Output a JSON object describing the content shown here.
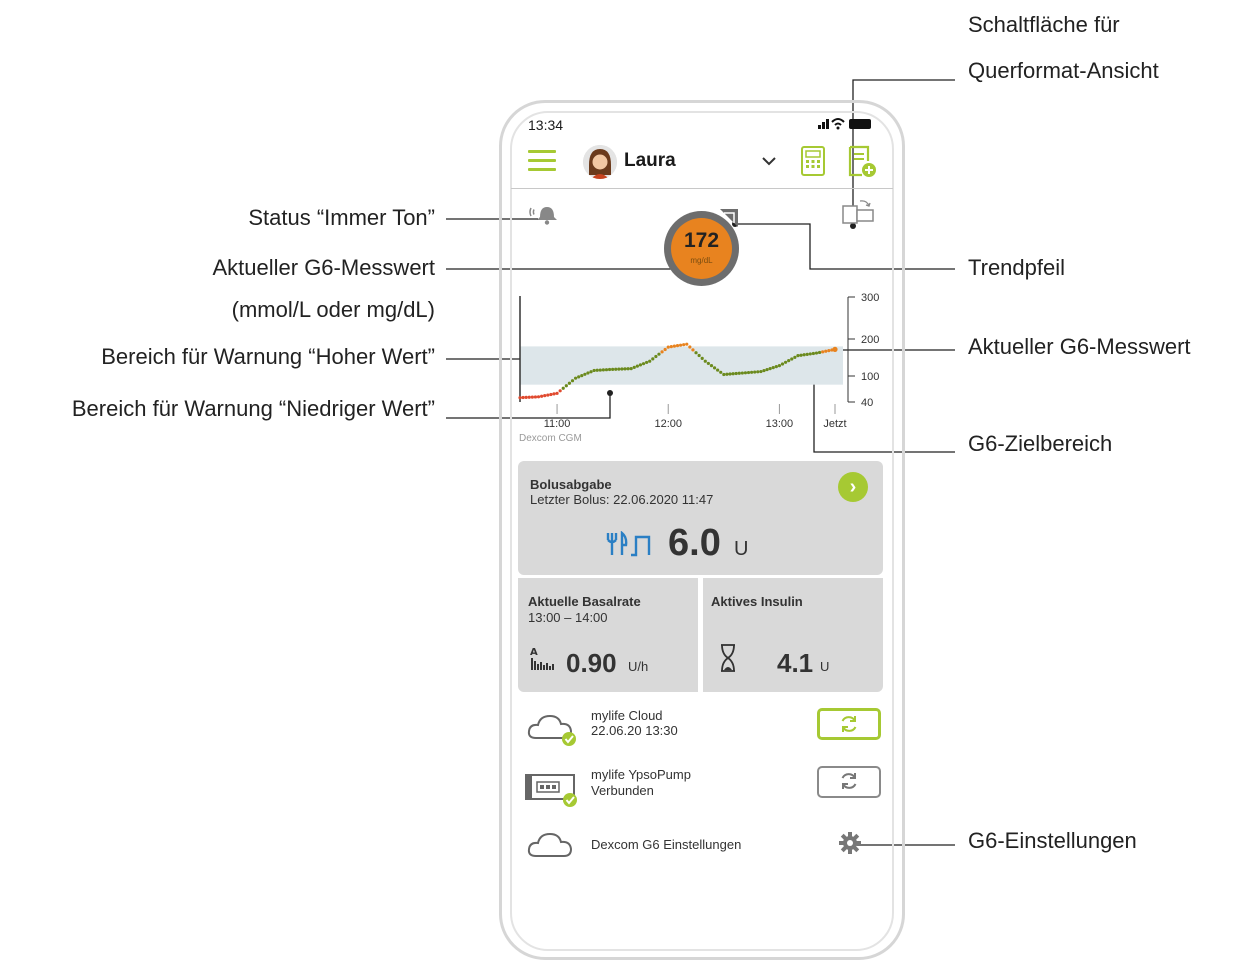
{
  "callouts": {
    "landscape_button_line1": "Schaltfläche für",
    "landscape_button_line2": "Querformat-Ansicht",
    "always_sound_status": "Status “Immer Ton”",
    "current_reading_left": "Aktueller G6-Messwert",
    "current_reading_units": "(mmol/L oder mg/dL)",
    "trend_arrow": "Trendpfeil",
    "current_reading_right": "Aktueller G6-Messwert",
    "high_alert_range": "Bereich für Warnung “Hoher Wert”",
    "low_alert_range": "Bereich für Warnung “Niedriger Wert”",
    "target_range": "G6-Zielbereich",
    "g6_settings": "G6-Einstellungen"
  },
  "status_bar": {
    "time": "13:34",
    "icons": "signal-icon wifi-icon battery-icon"
  },
  "header": {
    "user_name": "Laura",
    "dropdown_icon": "chevron-down-icon",
    "calculator_icon": "calculator-icon",
    "logbook_icon": "logbook-add-icon"
  },
  "glucose": {
    "value": "172",
    "unit": "mg/dL",
    "trend": "trend-arrow-right-up"
  },
  "colors": {
    "accent": "#a6c933",
    "glucose_orange": "#e8831f",
    "in_range_green": "#6b8a1e",
    "low_red": "#e04a2f",
    "target_band": "#dde6ea",
    "card_bg": "#d9d9d9"
  },
  "chart_data": {
    "type": "line",
    "source_label": "Dexcom CGM",
    "x_ticks": [
      "11:00",
      "12:00",
      "13:00",
      "Jetzt"
    ],
    "y_ticks": [
      "300",
      "200",
      "100",
      "40"
    ],
    "ylim": [
      40,
      300
    ],
    "target_range": [
      80,
      180
    ],
    "series": [
      {
        "x": [
          "10:40",
          "10:50",
          "11:00",
          "11:10",
          "11:20",
          "11:30",
          "11:40",
          "11:50",
          "12:00",
          "12:10",
          "12:20",
          "12:30",
          "12:40",
          "12:50",
          "13:00",
          "13:10",
          "13:20",
          "13:30"
        ],
        "y": [
          50,
          52,
          60,
          95,
          115,
          118,
          120,
          140,
          178,
          186,
          140,
          104,
          108,
          112,
          128,
          155,
          162,
          172
        ]
      }
    ]
  },
  "bolus": {
    "title": "Bolusabgabe",
    "last": "Letzter Bolus: 22.06.2020  11:47",
    "value": "6.0",
    "unit": "U",
    "icon": "meal-bolus-icon"
  },
  "basal": {
    "title": "Aktuelle Basalrate",
    "range": "13:00 – 14:00",
    "value": "0.90",
    "unit": "U/h",
    "icon": "basal-profile-icon"
  },
  "active_insulin": {
    "title": "Aktives Insulin",
    "value": "4.1",
    "unit": "U",
    "icon": "hourglass-icon"
  },
  "cloud": {
    "name": "mylife Cloud",
    "time": "22.06.20  13:30"
  },
  "pump": {
    "name": "mylife YpsoPump",
    "state": "Verbunden"
  },
  "dexcom": {
    "label": "Dexcom G6 Einstellungen"
  }
}
